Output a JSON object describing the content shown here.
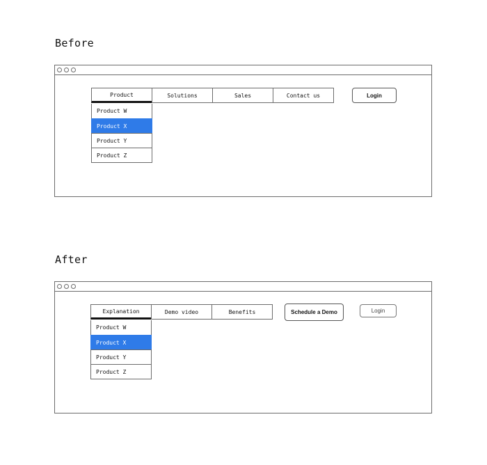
{
  "before": {
    "heading": "Before",
    "nav": [
      "Product",
      "Solutions",
      "Sales",
      "Contact us"
    ],
    "active_nav": "Product",
    "dropdown": [
      "Product W",
      "Product X",
      "Product Y",
      "Product Z"
    ],
    "selected_item": "Product X",
    "login_label": "Login"
  },
  "after": {
    "heading": "After",
    "nav": [
      "Explanation",
      "Demo video",
      "Benefits"
    ],
    "active_nav": "Explanation",
    "dropdown": [
      "Product W",
      "Product X",
      "Product Y",
      "Product Z"
    ],
    "selected_item": "Product X",
    "cta_label": "Schedule a Demo",
    "login_label": "Login"
  },
  "colors": {
    "highlight": "#2f7be8",
    "border": "#6b6b6b"
  }
}
